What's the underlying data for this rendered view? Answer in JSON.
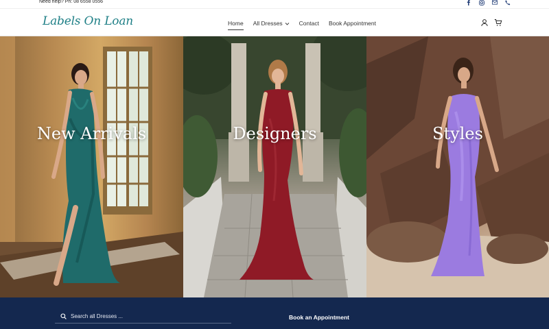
{
  "topbar": {
    "help_text": "Need help? Ph: 08 6558 0556",
    "socials": [
      "facebook-icon",
      "instagram-icon",
      "mail-icon",
      "phone-icon"
    ]
  },
  "header": {
    "logo": "Labels On Loan",
    "nav": [
      {
        "label": "Home",
        "active": true
      },
      {
        "label": "All Dresses",
        "has_dropdown": true
      },
      {
        "label": "Contact"
      },
      {
        "label": "Book Appointment"
      }
    ],
    "icons": [
      "user-icon",
      "cart-icon"
    ]
  },
  "hero": {
    "panels": [
      {
        "title": "New Arrivals"
      },
      {
        "title": "Designers"
      },
      {
        "title": "Styles"
      }
    ]
  },
  "footer": {
    "search_placeholder": "Search all Dresses ...",
    "book_label": "Book an Appointment"
  },
  "colors": {
    "footer_bg": "#14284f",
    "logo": "#1e7f86",
    "dress_teal": "#1f6b6a",
    "dress_red": "#8f1a26",
    "dress_lilac": "#9b7be0"
  }
}
